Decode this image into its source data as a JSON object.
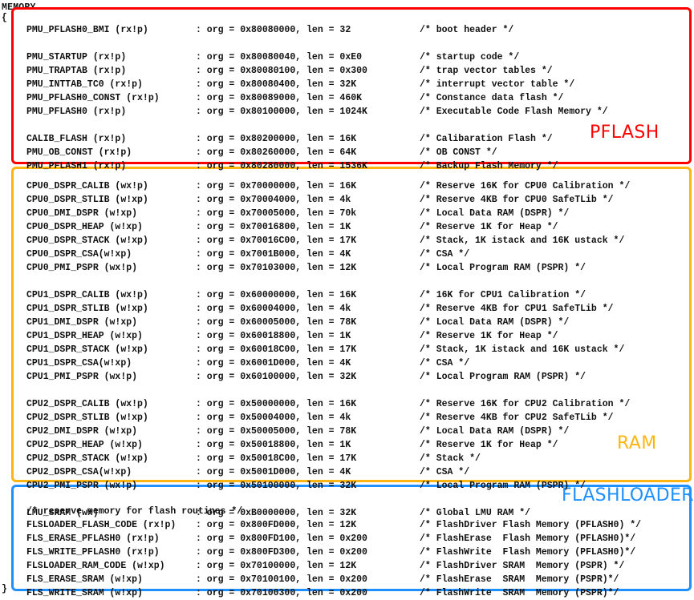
{
  "document": {
    "keyword": "MEMORY",
    "open_brace": "{",
    "close_brace": "}"
  },
  "colors": {
    "pflash": "#FF0000",
    "ram": "#FFB511",
    "flashloader": "#1E90FF",
    "text": "#111111",
    "background": "#FFFFFF"
  },
  "groups": [
    {
      "id": "pflash",
      "label": "PFLASH",
      "color": "#FF0000",
      "rows": [
        {
          "name": "PMU_PFLASH0_BMI (rx!p)",
          "org": ": org = 0x80080000, len = 32",
          "comment": "/* boot header */"
        },
        {
          "name": "",
          "org": "",
          "comment": ""
        },
        {
          "name": "PMU_STARTUP (rx!p)",
          "org": ": org = 0x80080040, len = 0xE0",
          "comment": "/* startup code */"
        },
        {
          "name": "PMU_TRAPTAB (rx!p)",
          "org": ": org = 0x80080100, len = 0x300",
          "comment": "/* trap vector tables */"
        },
        {
          "name": "PMU_INTTAB_TC0 (rx!p)",
          "org": ": org = 0x80080400, len = 32K",
          "comment": "/* interrupt vector table */"
        },
        {
          "name": "PMU_PFLASH0_CONST (rx!p)",
          "org": ": org = 0x80089000, len = 460K",
          "comment": "/* Constance data flash */"
        },
        {
          "name": "PMU_PFLASH0 (rx!p)",
          "org": ": org = 0x80100000, len = 1024K",
          "comment": "/* Executable Code Flash Memory */"
        },
        {
          "name": "",
          "org": "",
          "comment": ""
        },
        {
          "name": "CALIB_FLASH (rx!p)",
          "org": ": org = 0x80200000, len = 16K",
          "comment": "/* Calibaration Flash */"
        },
        {
          "name": "PMU_OB_CONST (rx!p)",
          "org": ": org = 0x80260000, len = 64K",
          "comment": "/* OB CONST */"
        },
        {
          "name": "PMU_PFLASH1 (rx!p)",
          "org": ": org = 0x80280000, len = 1536K",
          "comment": "/* Backup Flash Memory */"
        }
      ]
    },
    {
      "id": "ram",
      "label": "RAM",
      "color": "#FFB511",
      "rows": [
        {
          "name": "CPU0_DSPR_CALIB (wx!p)",
          "org": ": org = 0x70000000, len = 16K",
          "comment": "/* Reserve 16K for CPU0 Calibration */"
        },
        {
          "name": "CPU0_DSPR_STLIB (w!xp)",
          "org": ": org = 0x70004000, len = 4k",
          "comment": "/* Reserve 4KB for CPU0 SafeTLib */"
        },
        {
          "name": "CPU0_DMI_DSPR (w!xp)",
          "org": ": org = 0x70005000, len = 70k",
          "comment": "/* Local Data RAM (DSPR) */"
        },
        {
          "name": "CPU0_DSPR_HEAP (w!xp)",
          "org": ": org = 0x70016800, len = 1K",
          "comment": "/* Reserve 1K for Heap */"
        },
        {
          "name": "CPU0_DSPR_STACK (w!xp)",
          "org": ": org = 0x70016C00, len = 17K",
          "comment": "/* Stack, 1K istack and 16K ustack */"
        },
        {
          "name": "CPU0_DSPR_CSA(w!xp)",
          "org": ": org = 0x7001B000, len = 4K",
          "comment": "/* CSA */"
        },
        {
          "name": "CPU0_PMI_PSPR (wx!p)",
          "org": ": org = 0x70103000, len = 12K",
          "comment": "/* Local Program RAM (PSPR) */"
        },
        {
          "name": "",
          "org": "",
          "comment": ""
        },
        {
          "name": "CPU1_DSPR_CALIB (wx!p)",
          "org": ": org = 0x60000000, len = 16K",
          "comment": "/* 16K for CPU1 Calibration */"
        },
        {
          "name": "CPU1_DSPR_STLIB (w!xp)",
          "org": ": org = 0x60004000, len = 4k",
          "comment": "/* Reserve 4KB for CPU1 SafeTLib */"
        },
        {
          "name": "CPU1_DMI_DSPR (w!xp)",
          "org": ": org = 0x60005000, len = 78K",
          "comment": "/* Local Data RAM (DSPR) */"
        },
        {
          "name": "CPU1_DSPR_HEAP (w!xp)",
          "org": ": org = 0x60018800, len = 1K",
          "comment": "/* Reserve 1K for Heap */"
        },
        {
          "name": "CPU1_DSPR_STACK (w!xp)",
          "org": ": org = 0x60018C00, len = 17K",
          "comment": "/* Stack, 1K istack and 16K ustack */"
        },
        {
          "name": "CPU1_DSPR_CSA(w!xp)",
          "org": ": org = 0x6001D000, len = 4K",
          "comment": "/* CSA */"
        },
        {
          "name": "CPU1_PMI_PSPR (wx!p)",
          "org": ": org = 0x60100000, len = 32K",
          "comment": "/* Local Program RAM (PSPR) */"
        },
        {
          "name": "",
          "org": "",
          "comment": ""
        },
        {
          "name": "CPU2_DSPR_CALIB (wx!p)",
          "org": ": org = 0x50000000, len = 16K",
          "comment": "/* Reserve 16K for CPU2 Calibration */"
        },
        {
          "name": "CPU2_DSPR_STLIB (w!xp)",
          "org": ": org = 0x50004000, len = 4k",
          "comment": "/* Reserve 4KB for CPU2 SafeTLib */"
        },
        {
          "name": "CPU2_DMI_DSPR (w!xp)",
          "org": ": org = 0x50005000, len = 78K",
          "comment": "/* Local Data RAM (DSPR) */"
        },
        {
          "name": "CPU2_DSPR_HEAP (w!xp)",
          "org": ": org = 0x50018800, len = 1K",
          "comment": "/* Reserve 1K for Heap */"
        },
        {
          "name": "CPU2_DSPR_STACK (w!xp)",
          "org": ": org = 0x50018C00, len = 17K",
          "comment": "/* Stack */"
        },
        {
          "name": "CPU2_DSPR_CSA(w!xp)",
          "org": ": org = 0x5001D000, len = 4K",
          "comment": "/* CSA */"
        },
        {
          "name": "CPU2_PMI_PSPR (wx!p)",
          "org": ": org = 0x50100000, len = 32K",
          "comment": "/* Local Program RAM (PSPR) */"
        },
        {
          "name": "",
          "org": "",
          "comment": ""
        },
        {
          "name": "LMU_SRAM (wx)",
          "org": ": org = 0xB0000000, len = 32K",
          "comment": "/* Global LMU RAM */"
        }
      ]
    },
    {
      "id": "flashloader",
      "label": "FLASHLOADER",
      "color": "#1E90FF",
      "rows": [
        {
          "name": "/* reserve memory for flash routines */",
          "org": "",
          "comment": "",
          "full_width": true
        },
        {
          "name": "FLSLOADER_FLASH_CODE (rx!p)",
          "org": ": org = 0x800FD000, len = 12K",
          "comment": "/* FlashDriver Flash Memory (PFLASH0) */"
        },
        {
          "name": "FLS_ERASE_PFLASH0 (rx!p)",
          "org": ": org = 0x800FD100, len = 0x200",
          "comment": "/* FlashErase  Flash Memory (PFLASH0)*/"
        },
        {
          "name": "FLS_WRITE_PFLASH0 (rx!p)",
          "org": ": org = 0x800FD300, len = 0x200",
          "comment": "/* FlashWrite  Flash Memory (PFLASH0)*/"
        },
        {
          "name": "FLSLOADER_RAM_CODE (w!xp)",
          "org": ": org = 0x70100000, len = 12K",
          "comment": "/* FlashDriver SRAM  Memory (PSPR) */"
        },
        {
          "name": "FLS_ERASE_SRAM (w!xp)",
          "org": ": org = 0x70100100, len = 0x200",
          "comment": "/* FlashErase  SRAM  Memory (PSPR)*/"
        },
        {
          "name": "FLS_WRITE_SRAM (w!xp)",
          "org": ": org = 0x70100300, len = 0x200",
          "comment": "/* FlashWrite  SRAM  Memory (PSPR)*/"
        }
      ]
    }
  ],
  "layout": {
    "line_height": 17,
    "group_tops": {
      "pflash": 29,
      "ram": 224,
      "flashloader": 630
    }
  }
}
